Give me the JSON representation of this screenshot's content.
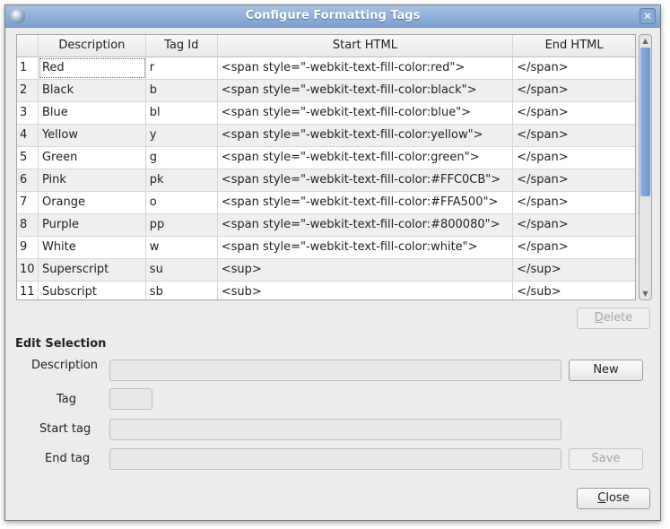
{
  "window": {
    "title": "Configure Formatting Tags"
  },
  "table": {
    "headers": [
      "",
      "Description",
      "Tag Id",
      "Start HTML",
      "End HTML"
    ],
    "rows": [
      [
        "1",
        "Red",
        "r",
        "<span style=\"-webkit-text-fill-color:red\">",
        "</span>"
      ],
      [
        "2",
        "Black",
        "b",
        "<span style=\"-webkit-text-fill-color:black\">",
        "</span>"
      ],
      [
        "3",
        "Blue",
        "bl",
        "<span style=\"-webkit-text-fill-color:blue\">",
        "</span>"
      ],
      [
        "4",
        "Yellow",
        "y",
        "<span style=\"-webkit-text-fill-color:yellow\">",
        "</span>"
      ],
      [
        "5",
        "Green",
        "g",
        "<span style=\"-webkit-text-fill-color:green\">",
        "</span>"
      ],
      [
        "6",
        "Pink",
        "pk",
        "<span style=\"-webkit-text-fill-color:#FFC0CB\">",
        "</span>"
      ],
      [
        "7",
        "Orange",
        "o",
        "<span style=\"-webkit-text-fill-color:#FFA500\">",
        "</span>"
      ],
      [
        "8",
        "Purple",
        "pp",
        "<span style=\"-webkit-text-fill-color:#800080\">",
        "</span>"
      ],
      [
        "9",
        "White",
        "w",
        "<span style=\"-webkit-text-fill-color:white\">",
        "</span>"
      ],
      [
        "10",
        "Superscript",
        "su",
        "<sup>",
        "</sup>"
      ],
      [
        "11",
        "Subscript",
        "sb",
        "<sub>",
        "</sub>"
      ]
    ]
  },
  "buttons": {
    "delete_mn": "D",
    "delete_rest": "elete",
    "new": "New",
    "save": "Save",
    "close_mn": "C",
    "close_rest": "lose"
  },
  "edit": {
    "heading": "Edit Selection",
    "description_label": "Description",
    "tag_label": "Tag",
    "start_label": "Start tag",
    "end_label": "End tag",
    "description_value": "",
    "tag_value": "",
    "start_value": "",
    "end_value": ""
  }
}
